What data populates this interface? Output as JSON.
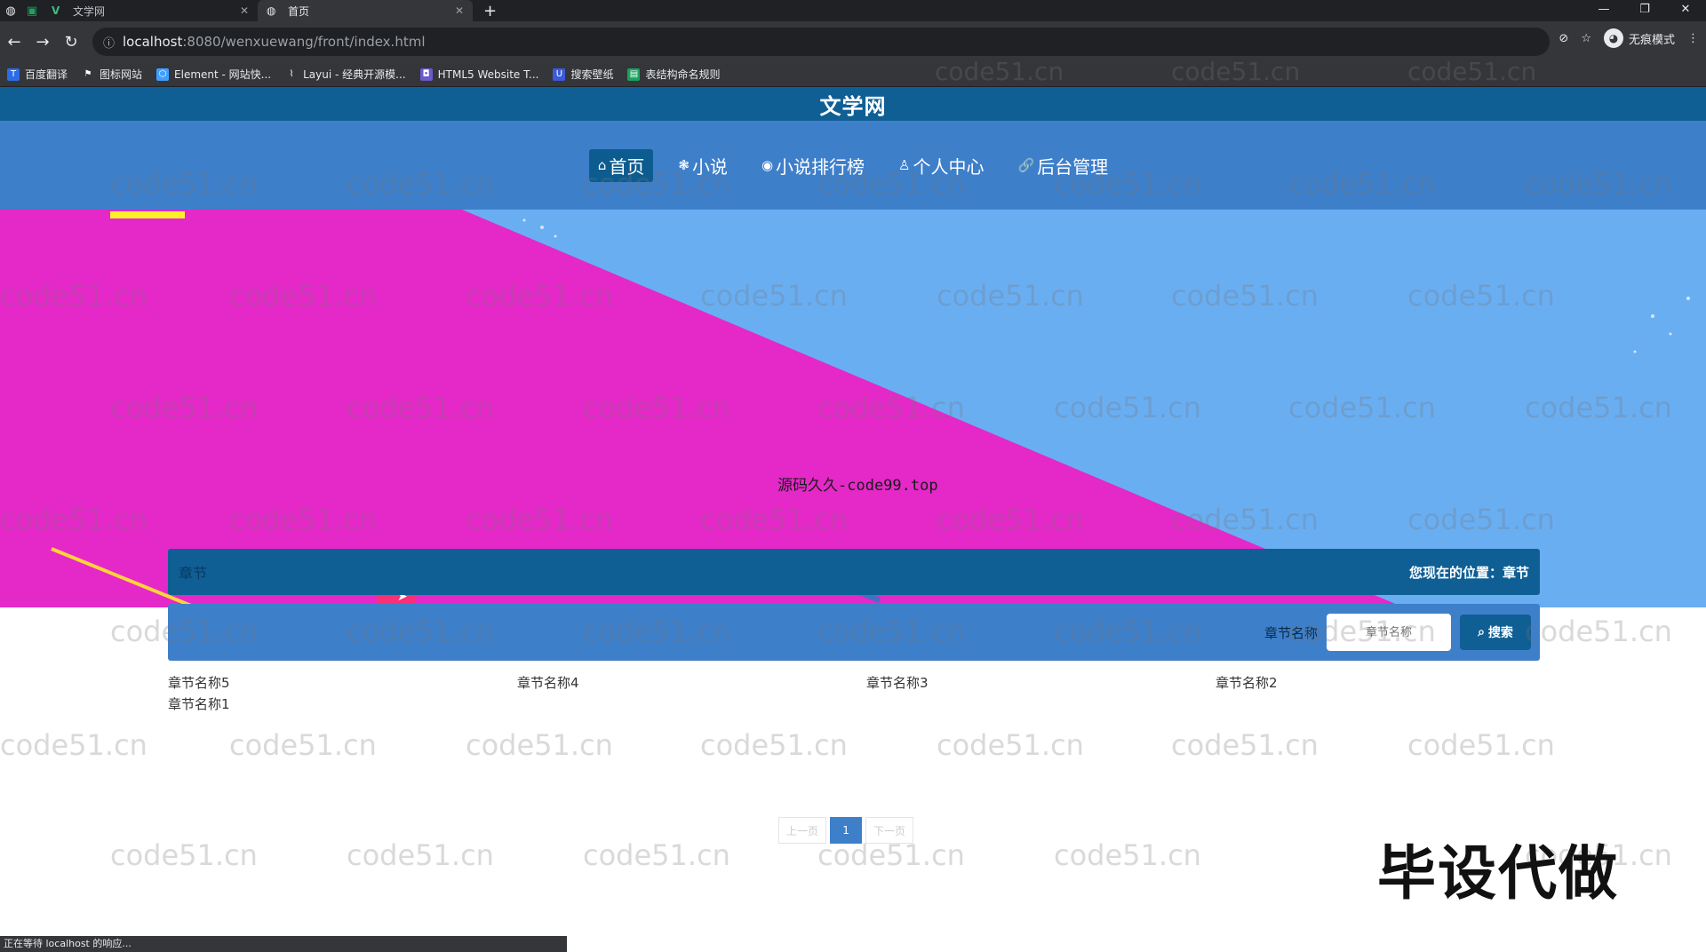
{
  "browser": {
    "tabs": [
      {
        "title": "文学网",
        "active": false
      },
      {
        "title": "首页",
        "active": true
      }
    ],
    "url_host": "localhost",
    "url_path": ":8080/wenxuewang/front/index.html",
    "incognito_label": "无痕模式",
    "bookmarks": [
      {
        "label": "百度翻译",
        "color": "#2b6de8"
      },
      {
        "label": "图标网站",
        "color": "#444444"
      },
      {
        "label": "Element - 网站快...",
        "color": "#409eff"
      },
      {
        "label": "Layui - 经典开源模...",
        "color": "#444444"
      },
      {
        "label": "HTML5 Website T...",
        "color": "#6a5acd"
      },
      {
        "label": "搜索壁纸",
        "color": "#3b5bdb"
      },
      {
        "label": "表结构命名规则",
        "color": "#1aa260"
      }
    ],
    "status_text": "正在等待 localhost 的响应..."
  },
  "site": {
    "title": "文学网",
    "nav": [
      {
        "icon": "⌂",
        "label": "首页",
        "active": true
      },
      {
        "icon": "❃",
        "label": "小说",
        "active": false
      },
      {
        "icon": "◉",
        "label": "小说排行榜",
        "active": false
      },
      {
        "icon": "♙",
        "label": "个人中心",
        "active": false
      },
      {
        "icon": "🔗",
        "label": "后台管理",
        "active": false
      }
    ],
    "banner_caption": "源码久久-code99.top",
    "carousel_dots": 3
  },
  "breadcrumb": {
    "section": "章节",
    "location": "您现在的位置：章节"
  },
  "search": {
    "label": "章节名称",
    "placeholder": "章节名称",
    "button": "搜索"
  },
  "chapters": [
    "章节名称5",
    "章节名称4",
    "章节名称3",
    "章节名称2",
    "章节名称1"
  ],
  "pagination": {
    "prev": "上一页",
    "current": "1",
    "next": "下一页"
  },
  "watermark_text": "code51.cn",
  "corner_mark": "毕设代做",
  "colors": {
    "header": "#0f5f95",
    "navbar": "#3e7fca",
    "banner_magenta": "#e528c8",
    "banner_blue": "#6aaef2"
  }
}
